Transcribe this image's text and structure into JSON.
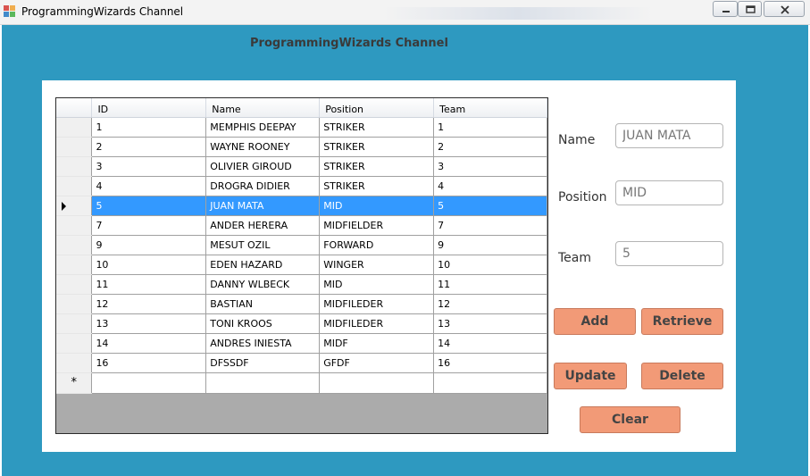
{
  "window": {
    "title": "ProgrammingWizards Channel"
  },
  "form": {
    "heading": "ProgrammingWizards Channel"
  },
  "grid": {
    "columns": [
      "ID",
      "Name",
      "Position",
      "Team"
    ],
    "rows": [
      [
        "1",
        "MEMPHIS DEEPAY",
        "STRIKER",
        "1"
      ],
      [
        "2",
        "WAYNE ROONEY",
        "STRIKER",
        "2"
      ],
      [
        "3",
        "OLIVIER GIROUD",
        "STRIKER",
        "3"
      ],
      [
        "4",
        "DROGRA DIDIER",
        "STRIKER",
        "4"
      ],
      [
        "5",
        "JUAN MATA",
        "MID",
        "5"
      ],
      [
        "7",
        "ANDER HERERA",
        "MIDFIELDER",
        "7"
      ],
      [
        "9",
        "MESUT OZIL",
        "FORWARD",
        "9"
      ],
      [
        "10",
        "EDEN HAZARD",
        "WINGER",
        "10"
      ],
      [
        "11",
        "DANNY WLBECK",
        "MID",
        "11"
      ],
      [
        "12",
        "BASTIAN",
        "MIDFILEDER",
        "12"
      ],
      [
        "13",
        "TONI KROOS",
        "MIDFILEDER",
        "13"
      ],
      [
        "14",
        "ANDRES INIESTA",
        "MIDF",
        "14"
      ],
      [
        "16",
        "DFSSDF",
        "GFDF",
        "16"
      ]
    ],
    "selected_row_index": 4,
    "new_row_marker": "*"
  },
  "fields": {
    "name": {
      "label": "Name",
      "value": "JUAN MATA"
    },
    "position": {
      "label": "Position",
      "value": "MID"
    },
    "team": {
      "label": "Team",
      "value": "5"
    }
  },
  "buttons": {
    "add": "Add",
    "retrieve": "Retrieve",
    "update": "Update",
    "delete": "Delete",
    "clear": "Clear"
  },
  "colors": {
    "form_background": "#2e99c0",
    "button_fill": "#f29a77",
    "selection": "#3399ff"
  }
}
